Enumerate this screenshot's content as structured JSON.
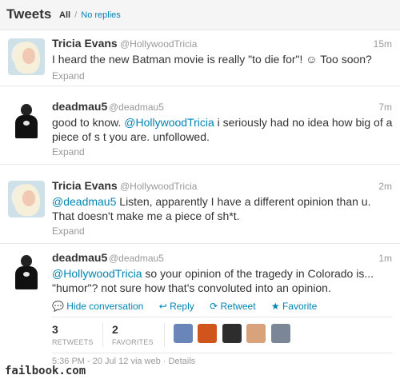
{
  "header": {
    "title": "Tweets",
    "filter_all": "All",
    "filter_sep": "/",
    "filter_replies": "No replies"
  },
  "tweets": [
    {
      "name": "Tricia Evans",
      "handle": "@HollywoodTricia",
      "time": "15m",
      "text": "I heard the new Batman movie is really \"to die for\"! ☺ Too soon?",
      "expand": "Expand"
    },
    {
      "name": "deadmau5",
      "handle": "@deadmau5",
      "time": "7m",
      "text_before": "good to know. ",
      "mention": "@HollywoodTricia",
      "text_after": " i seriously had no idea how big of a piece of s  t you are. unfollowed.",
      "expand": "Expand"
    },
    {
      "name": "Tricia Evans",
      "handle": "@HollywoodTricia",
      "time": "2m",
      "mention": "@deadmau5",
      "text_after": " Listen, apparently I have a different opinion than u. That doesn't make me a piece of sh*t.",
      "expand": "Expand"
    },
    {
      "name": "deadmau5",
      "handle": "@deadmau5",
      "time": "1m",
      "mention": "@HollywoodTricia",
      "text_after": " so your opinion of the tragedy in Colorado is... \"humor\"? not sure how that's convoluted into an opinion.",
      "actions": {
        "hide": "Hide conversation",
        "reply": "Reply",
        "retweet": "Retweet",
        "favorite": "Favorite"
      },
      "stats": {
        "retweets": "3",
        "retweets_label": "RETWEETS",
        "favorites": "2",
        "favorites_label": "FAVORITES"
      },
      "meta": "5:36 PM - 20 Jul 12 via web · Details"
    }
  ],
  "footer": {
    "watermark": "failbook.com"
  }
}
